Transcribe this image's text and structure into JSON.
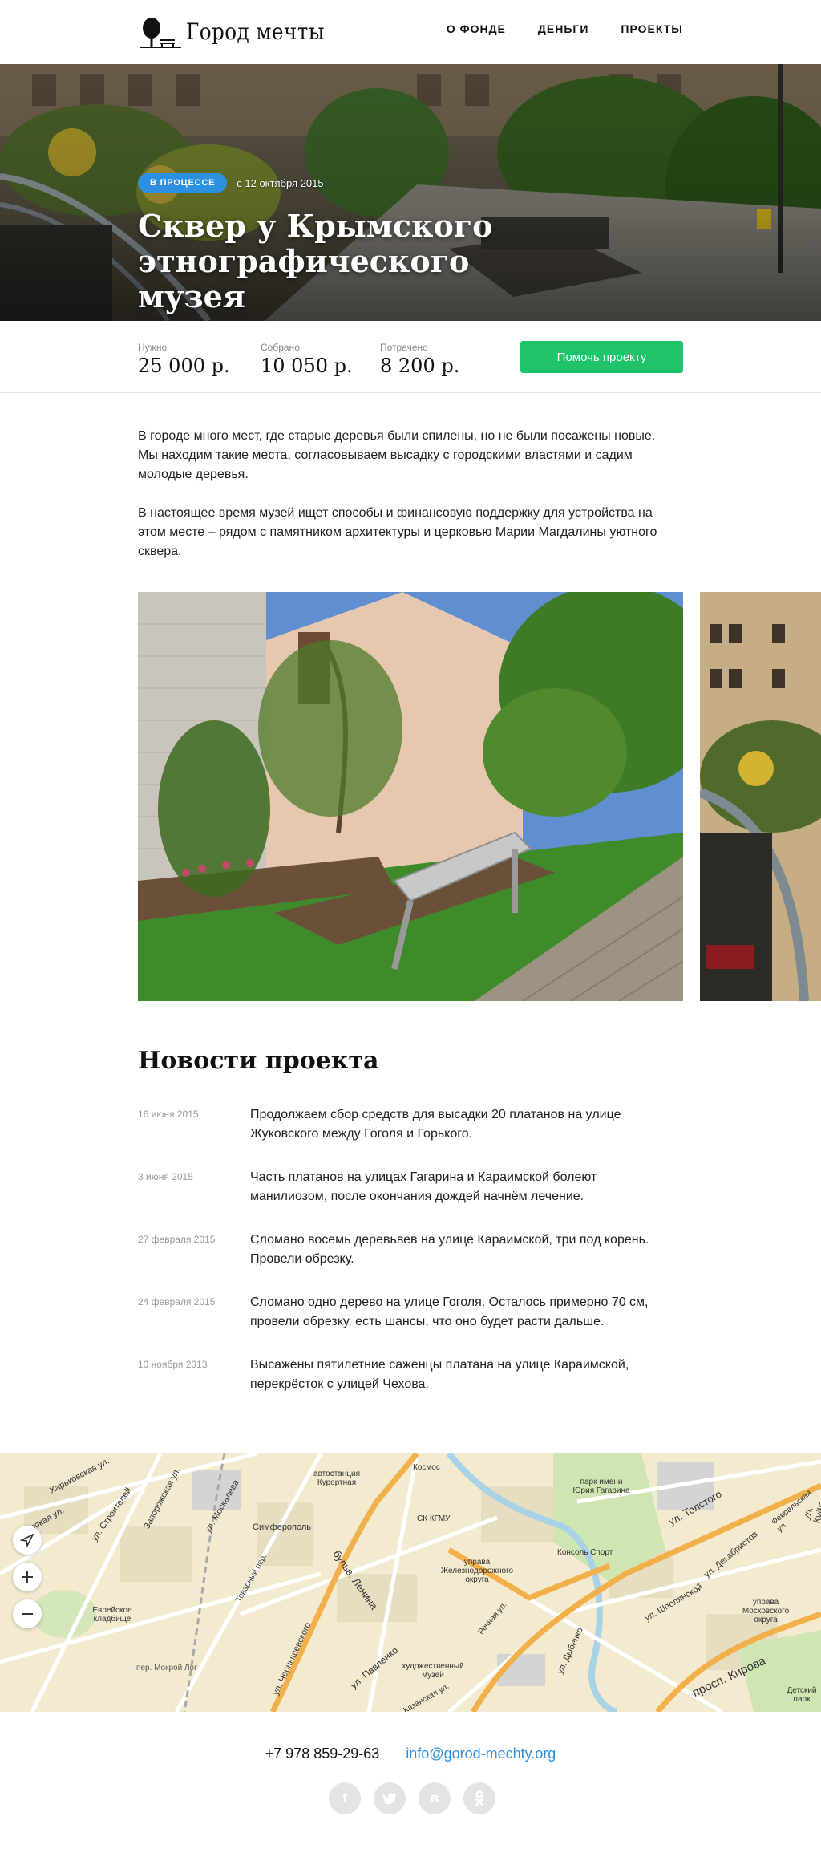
{
  "header": {
    "logo_text": "Город мечты",
    "nav": [
      "О фонде",
      "Деньги",
      "Проекты"
    ]
  },
  "hero": {
    "status_badge": "В процессе",
    "date": "с 12 октября 2015",
    "title": "Сквер у Крымского этнографического музея"
  },
  "stats": {
    "needed_label": "Нужно",
    "needed_value": "25 000 р.",
    "collected_label": "Собрано",
    "collected_value": "10 050 р.",
    "spent_label": "Потрачено",
    "spent_value": "8 200 р.",
    "help_button": "Помочь проекту"
  },
  "description": {
    "p1": "В городе много мест, где старые деревья были спилены, но не были посажены новые. Мы находим такие места, согласовываем высадку с городскими властями и садим молодые деревья.",
    "p2": "В настоящее время музей ищет способы и финансовую поддержку для устройства на этом месте – рядом с памятником архитектуры и церковью Марии Магдалины уютного сквера."
  },
  "news": {
    "title": "Новости проекта",
    "items": [
      {
        "date": "16 июня 2015",
        "text": "Продолжаем сбор средств для высадки 20 платанов на улице Жуковского между Гоголя и Горького."
      },
      {
        "date": "3 июня 2015",
        "text": "Часть платанов на улицах Гагарина и Караимской болеют манилиозом, после окончания дождей начнём лечение."
      },
      {
        "date": "27 февраля 2015",
        "text": "Сломано восемь деревьвев на улице Караимской, три под корень. Провели обрезку."
      },
      {
        "date": "24 февраля 2015",
        "text": "Сломано одно дерево на улице Гоголя. Осталось примерно 70 см, провели обрезку, есть шансы, что оно будет расти дальше."
      },
      {
        "date": "10 ноября 2013",
        "text": "Высажены пятилетние саженцы платана на улице Караимской, перекрёсток с улицей Чехова."
      }
    ]
  },
  "map": {
    "labels": [
      "Харьковская ул.",
      "ул. Строителей",
      "Широкая ул.",
      "Запорожская ул.",
      "ул. Москалёва",
      "автостанция Курортная",
      "Симферополь",
      "Космос",
      "СК КГМУ",
      "парк имени Юрия Гагарина",
      "ул. Толстого",
      "Февральская ул.",
      "Консоль Спорт",
      "управа Железнодорожного округа",
      "Еврейское кладбище",
      "Товарный пер.",
      "бульв. Ленина",
      "ул. Декабристов",
      "ул. Шполянской",
      "управа Московского округа",
      "ул. Куйбышева",
      "ул. Павленко",
      "ул. Чернышевского",
      "пер. Мокрой Лог",
      "художественный музей",
      "ул. Дыбенко",
      "просп. Кирова",
      "Детский парк",
      "Речная ул.",
      "Казанская ул."
    ]
  },
  "footer": {
    "phone": "+7 978 859-29-63",
    "email": "info@gorod-mechty.org",
    "socials": [
      "f",
      "t",
      "в",
      "ok"
    ]
  }
}
